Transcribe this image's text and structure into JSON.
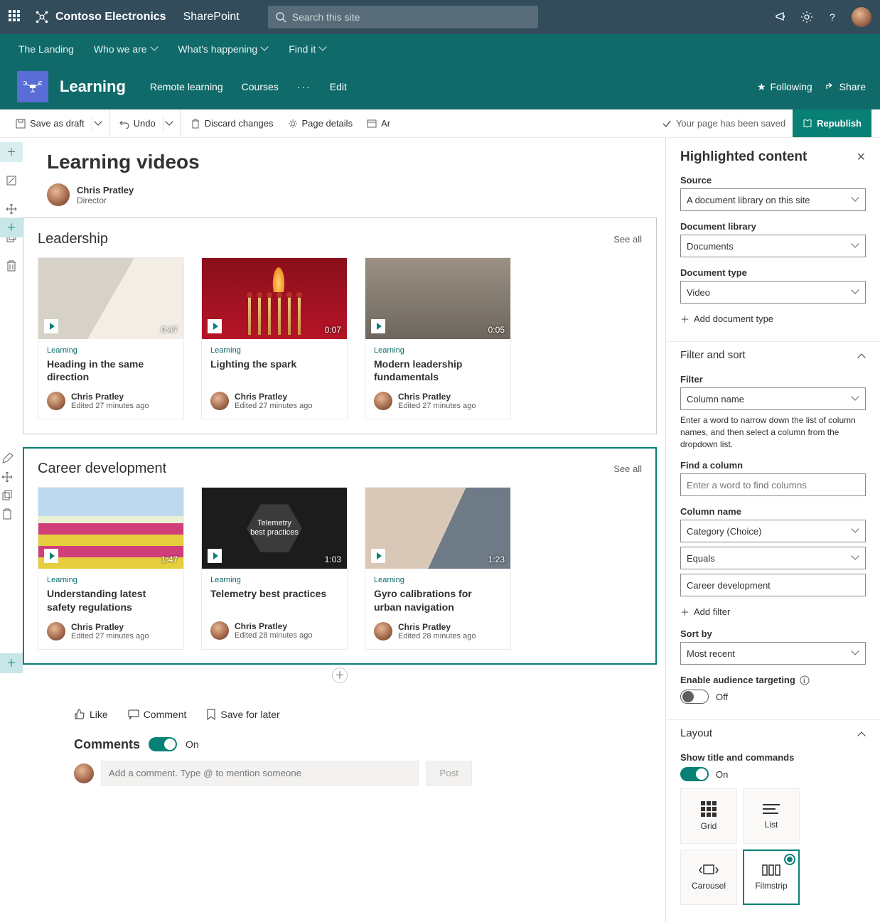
{
  "suite": {
    "brand": "Contoso Electronics",
    "app": "SharePoint",
    "search_placeholder": "Search this site"
  },
  "hub_nav": {
    "items": [
      "The Landing",
      "Who we are",
      "What's happening",
      "Find it"
    ],
    "has_dropdown": [
      false,
      true,
      true,
      true
    ]
  },
  "site": {
    "title": "Learning",
    "nav": [
      "Remote learning",
      "Courses"
    ],
    "more": "···",
    "edit": "Edit",
    "following": "Following",
    "share": "Share"
  },
  "cmdbar": {
    "save_draft": "Save as draft",
    "undo": "Undo",
    "discard": "Discard changes",
    "page_details": "Page details",
    "ar": "Ar",
    "saved_msg": "Your page has been saved",
    "republish": "Republish"
  },
  "page": {
    "title": "Learning videos",
    "author": "Chris Pratley",
    "role": "Director"
  },
  "sections": [
    {
      "title": "Leadership",
      "see_all": "See all",
      "cards": [
        {
          "thumb": "office",
          "duration": "0:47",
          "category": "Learning",
          "title": "Heading in the same direction",
          "author": "Chris Pratley",
          "edited": "Edited 27 minutes ago"
        },
        {
          "thumb": "match",
          "duration": "0:07",
          "category": "Learning",
          "title": "Lighting the spark",
          "author": "Chris Pratley",
          "edited": "Edited 27 minutes ago"
        },
        {
          "thumb": "meeting",
          "duration": "0:05",
          "category": "Learning",
          "title": "Modern leadership fundamentals",
          "author": "Chris Pratley",
          "edited": "Edited 27 minutes ago"
        }
      ]
    },
    {
      "title": "Career development",
      "see_all": "See all",
      "selected": true,
      "cards": [
        {
          "thumb": "drone",
          "duration": "1:47",
          "category": "Learning",
          "title": "Understanding latest safety regulations",
          "author": "Chris Pratley",
          "edited": "Edited 27 minutes ago"
        },
        {
          "thumb": "telemetry",
          "hex_text": "Telemetry best practices",
          "duration": "1:03",
          "category": "Learning",
          "title": "Telemetry best practices",
          "author": "Chris Pratley",
          "edited": "Edited 28 minutes ago"
        },
        {
          "thumb": "gyro",
          "duration": "1:23",
          "category": "Learning",
          "title": "Gyro calibrations for urban navigation",
          "author": "Chris Pratley",
          "edited": "Edited 28 minutes ago"
        }
      ]
    }
  ],
  "social": {
    "like": "Like",
    "comment": "Comment",
    "save": "Save for later"
  },
  "comments": {
    "heading": "Comments",
    "toggle_label": "On",
    "input_placeholder": "Add a comment. Type @ to mention someone",
    "post": "Post"
  },
  "pane": {
    "title": "Highlighted content",
    "source_label": "Source",
    "source_value": "A document library on this site",
    "doclib_label": "Document library",
    "doclib_value": "Documents",
    "doctype_label": "Document type",
    "doctype_value": "Video",
    "add_doctype": "Add document type",
    "filter_sort_header": "Filter and sort",
    "filter_label": "Filter",
    "filter_value": "Column name",
    "filter_help": "Enter a word to narrow down the list of column names, and then select a column from the dropdown list.",
    "find_column_label": "Find a column",
    "find_column_placeholder": "Enter a word to find columns",
    "column_name_label": "Column name",
    "column_name_value": "Category (Choice)",
    "operator_value": "Equals",
    "value_value": "Career development",
    "add_filter": "Add filter",
    "sort_by_label": "Sort by",
    "sort_by_value": "Most recent",
    "audience_label": "Enable audience targeting",
    "audience_state": "Off",
    "layout_header": "Layout",
    "show_title_label": "Show title and commands",
    "show_title_state": "On",
    "layouts": [
      "Grid",
      "List",
      "Carousel",
      "Filmstrip"
    ],
    "layout_selected": "Filmstrip"
  }
}
